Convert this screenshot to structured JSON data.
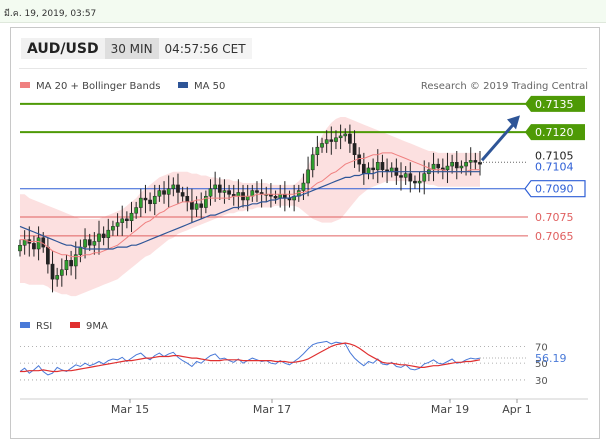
{
  "timestamp": "มี.ค. 19, 2019, 03:57",
  "header": {
    "symbol": "AUD/USD",
    "timeframe": "30 MIN",
    "clock": "04:57:56 CET"
  },
  "legend": {
    "ma20": {
      "label": "MA 20 + Bollinger Bands",
      "color": "#f08080"
    },
    "ma50": {
      "label": "MA 50",
      "color": "#2e5597"
    },
    "research": "Research © 2019 Trading Central",
    "rsi": {
      "label": "RSI",
      "color": "#4a7ad8"
    },
    "ma9": {
      "label": "9MA",
      "color": "#e03030"
    }
  },
  "chart_data": [
    {
      "type": "candlestick",
      "x_ticks": [
        "Mar 15",
        "Mar 17",
        "Mar 19",
        "Apr 1"
      ],
      "ylim": [
        0.7023,
        0.7145
      ],
      "grid": false,
      "levels": [
        {
          "value": 0.7135,
          "label": "0.7135",
          "kind": "resistance",
          "color": "#4e9a06"
        },
        {
          "value": 0.712,
          "label": "0.7120",
          "kind": "resistance",
          "color": "#4e9a06"
        },
        {
          "value": 0.709,
          "label": "0.7090",
          "kind": "pivot",
          "color": "#2e5fd6"
        },
        {
          "value": 0.7075,
          "label": "0.7075",
          "kind": "support",
          "color": "#e06060"
        },
        {
          "value": 0.7065,
          "label": "0.7065",
          "kind": "support",
          "color": "#e06060"
        }
      ],
      "current_price": {
        "value": 0.7104,
        "label": "0.7104"
      },
      "hidden_price_label": "0.7105",
      "close_series": [
        0.706,
        0.7063,
        0.7061,
        0.7058,
        0.7064,
        0.7059,
        0.705,
        0.7042,
        0.7044,
        0.7047,
        0.7052,
        0.7049,
        0.7055,
        0.7059,
        0.7063,
        0.706,
        0.7062,
        0.7066,
        0.7064,
        0.7068,
        0.707,
        0.7072,
        0.7074,
        0.7073,
        0.7077,
        0.708,
        0.7085,
        0.7084,
        0.7082,
        0.7086,
        0.7089,
        0.7087,
        0.709,
        0.7092,
        0.7088,
        0.7086,
        0.7083,
        0.7079,
        0.7082,
        0.708,
        0.7086,
        0.709,
        0.7092,
        0.7088,
        0.7089,
        0.7087,
        0.7086,
        0.7088,
        0.7084,
        0.7086,
        0.7089,
        0.7088,
        0.7087,
        0.7087,
        0.7086,
        0.7085,
        0.7087,
        0.7085,
        0.7084,
        0.7086,
        0.7089,
        0.7093,
        0.71,
        0.7108,
        0.7112,
        0.7114,
        0.7116,
        0.7115,
        0.7117,
        0.7118,
        0.7119,
        0.7114,
        0.7108,
        0.7103,
        0.7098,
        0.7101,
        0.71,
        0.7104,
        0.71,
        0.7099,
        0.7101,
        0.7097,
        0.7096,
        0.7098,
        0.7094,
        0.7093,
        0.7094,
        0.7098,
        0.71,
        0.7103,
        0.7101,
        0.71,
        0.7102,
        0.7104,
        0.7101,
        0.7102,
        0.7104,
        0.7105,
        0.7104,
        0.7103
      ],
      "series": [
        {
          "name": "MA 20 + Bollinger Bands",
          "ma20": [
            0.7063,
            0.7063,
            0.7062,
            0.7062,
            0.7062,
            0.7061,
            0.7059,
            0.7057,
            0.7056,
            0.7055,
            0.7055,
            0.7054,
            0.7054,
            0.7054,
            0.7055,
            0.7055,
            0.7056,
            0.7056,
            0.7057,
            0.7058,
            0.7059,
            0.706,
            0.7062,
            0.7064,
            0.7066,
            0.7068,
            0.707,
            0.7072,
            0.7073,
            0.7075,
            0.7077,
            0.7078,
            0.708,
            0.7081,
            0.7082,
            0.7083,
            0.7083,
            0.7083,
            0.7084,
            0.7084,
            0.7085,
            0.7085,
            0.7085,
            0.7085,
            0.7085,
            0.7085,
            0.7086,
            0.7086,
            0.7086,
            0.7086,
            0.7086,
            0.7087,
            0.7087,
            0.7087,
            0.7087,
            0.7087,
            0.7087,
            0.7087,
            0.7087,
            0.7087,
            0.7088,
            0.7088,
            0.7089,
            0.7091,
            0.7093,
            0.7094,
            0.7096,
            0.7098,
            0.7099,
            0.7101,
            0.7103,
            0.7104,
            0.7105,
            0.7106,
            0.7106,
            0.7107,
            0.7108,
            0.7108,
            0.7109,
            0.7109,
            0.7109,
            0.7108,
            0.7107,
            0.7106,
            0.7105,
            0.7104,
            0.7103,
            0.7102,
            0.7101,
            0.71,
            0.71,
            0.71,
            0.7099,
            0.7099,
            0.7099,
            0.7099,
            0.7099,
            0.71,
            0.71,
            0.71
          ],
          "upper": [
            0.7087,
            0.7087,
            0.7085,
            0.7084,
            0.7083,
            0.7082,
            0.7081,
            0.708,
            0.7079,
            0.7078,
            0.7077,
            0.7076,
            0.7075,
            0.7074,
            0.7074,
            0.7074,
            0.7074,
            0.7074,
            0.7075,
            0.7076,
            0.7077,
            0.7078,
            0.7079,
            0.7081,
            0.7083,
            0.7085,
            0.7088,
            0.709,
            0.7092,
            0.7094,
            0.7096,
            0.7097,
            0.7098,
            0.7099,
            0.7099,
            0.7099,
            0.7099,
            0.7098,
            0.7098,
            0.7097,
            0.7097,
            0.7096,
            0.7096,
            0.7095,
            0.7095,
            0.7095,
            0.7094,
            0.7094,
            0.7093,
            0.7093,
            0.7093,
            0.7093,
            0.7093,
            0.7093,
            0.7092,
            0.7092,
            0.7092,
            0.7092,
            0.7092,
            0.7092,
            0.7094,
            0.7097,
            0.7102,
            0.7108,
            0.7113,
            0.7118,
            0.7122,
            0.7125,
            0.7127,
            0.7128,
            0.7128,
            0.7127,
            0.7126,
            0.7125,
            0.7124,
            0.7123,
            0.7122,
            0.7121,
            0.712,
            0.7119,
            0.7118,
            0.7117,
            0.7116,
            0.7115,
            0.7114,
            0.7113,
            0.7112,
            0.7111,
            0.711,
            0.711,
            0.7109,
            0.7109,
            0.7109,
            0.7109,
            0.7109,
            0.7109,
            0.7109,
            0.7109,
            0.7109,
            0.7109
          ],
          "lower": [
            0.704,
            0.704,
            0.7039,
            0.7039,
            0.7039,
            0.7039,
            0.7038,
            0.7036,
            0.7035,
            0.7034,
            0.7034,
            0.7033,
            0.7033,
            0.7034,
            0.7035,
            0.7036,
            0.7037,
            0.7038,
            0.7039,
            0.704,
            0.7041,
            0.7042,
            0.7044,
            0.7046,
            0.7048,
            0.705,
            0.7052,
            0.7054,
            0.7055,
            0.7057,
            0.7059,
            0.7061,
            0.7063,
            0.7064,
            0.7066,
            0.7067,
            0.7068,
            0.7069,
            0.707,
            0.7071,
            0.7072,
            0.7073,
            0.7074,
            0.7075,
            0.7076,
            0.7077,
            0.7077,
            0.7078,
            0.7078,
            0.7079,
            0.7079,
            0.708,
            0.708,
            0.708,
            0.708,
            0.7081,
            0.7081,
            0.7081,
            0.7081,
            0.7081,
            0.708,
            0.7078,
            0.7076,
            0.7074,
            0.7073,
            0.7072,
            0.7072,
            0.7072,
            0.7073,
            0.7074,
            0.7077,
            0.708,
            0.7083,
            0.7086,
            0.7088,
            0.709,
            0.7091,
            0.7092,
            0.7093,
            0.7094,
            0.7094,
            0.7094,
            0.7094,
            0.7094,
            0.7094,
            0.7094,
            0.7093,
            0.7093,
            0.7092,
            0.7092,
            0.7091,
            0.7091,
            0.7091,
            0.7091,
            0.7091,
            0.7091,
            0.7091,
            0.7091,
            0.7091,
            0.7091
          ]
        },
        {
          "name": "MA 50",
          "values": [
            0.707,
            0.7069,
            0.7068,
            0.7067,
            0.7066,
            0.7065,
            0.7064,
            0.7063,
            0.7062,
            0.7061,
            0.706,
            0.706,
            0.7059,
            0.7059,
            0.7058,
            0.7058,
            0.7058,
            0.7058,
            0.7058,
            0.7058,
            0.7058,
            0.7059,
            0.7059,
            0.7059,
            0.706,
            0.706,
            0.7061,
            0.7062,
            0.7063,
            0.7064,
            0.7065,
            0.7066,
            0.7067,
            0.7068,
            0.7069,
            0.707,
            0.7071,
            0.7072,
            0.7073,
            0.7074,
            0.7075,
            0.7076,
            0.7076,
            0.7077,
            0.7078,
            0.7079,
            0.708,
            0.708,
            0.7081,
            0.7081,
            0.7082,
            0.7082,
            0.7083,
            0.7083,
            0.7084,
            0.7084,
            0.7085,
            0.7085,
            0.7085,
            0.7086,
            0.7086,
            0.7087,
            0.7088,
            0.7089,
            0.709,
            0.7091,
            0.7092,
            0.7093,
            0.7094,
            0.7095,
            0.7096,
            0.7096,
            0.7097,
            0.7097,
            0.7098,
            0.7098,
            0.7098,
            0.7099,
            0.7099,
            0.7099,
            0.7099,
            0.7099,
            0.7099,
            0.7099,
            0.7099,
            0.7099,
            0.7099,
            0.7099,
            0.7099,
            0.7099,
            0.7099,
            0.7099,
            0.7099,
            0.7099,
            0.7099,
            0.7099,
            0.7099,
            0.7099,
            0.7099,
            0.7099
          ]
        }
      ],
      "forecast": {
        "from": 0.7104,
        "to": 0.7131
      }
    },
    {
      "type": "line",
      "name": "RSI",
      "ylim": [
        18,
        80
      ],
      "y_ticks": [
        30,
        50,
        70
      ],
      "current": {
        "value": 56.19,
        "label": "56.19"
      },
      "series": [
        {
          "name": "RSI",
          "values": [
            40,
            44,
            38,
            42,
            47,
            40,
            36,
            38,
            45,
            42,
            40,
            44,
            48,
            46,
            50,
            47,
            49,
            52,
            49,
            53,
            55,
            54,
            57,
            52,
            56,
            60,
            62,
            57,
            54,
            59,
            62,
            58,
            61,
            63,
            57,
            53,
            50,
            46,
            52,
            50,
            55,
            59,
            61,
            55,
            56,
            53,
            51,
            55,
            50,
            53,
            56,
            54,
            52,
            53,
            50,
            49,
            53,
            50,
            48,
            52,
            56,
            61,
            67,
            72,
            74,
            75,
            76,
            73,
            75,
            74,
            73,
            63,
            56,
            51,
            47,
            52,
            50,
            55,
            49,
            48,
            51,
            46,
            45,
            48,
            43,
            42,
            44,
            49,
            51,
            54,
            50,
            49,
            52,
            55,
            50,
            51,
            54,
            56,
            55,
            56
          ]
        },
        {
          "name": "9MA",
          "values": [
            40,
            40,
            41,
            41,
            41,
            42,
            41,
            40,
            40,
            41,
            41,
            41,
            42,
            43,
            44,
            45,
            46,
            47,
            48,
            49,
            50,
            51,
            52,
            53,
            53,
            54,
            55,
            56,
            56,
            57,
            58,
            58,
            58,
            59,
            59,
            58,
            57,
            56,
            56,
            55,
            54,
            53,
            53,
            53,
            54,
            54,
            54,
            54,
            53,
            53,
            53,
            53,
            53,
            53,
            53,
            52,
            52,
            52,
            51,
            51,
            52,
            53,
            55,
            58,
            61,
            64,
            67,
            70,
            72,
            73,
            74,
            73,
            71,
            68,
            64,
            60,
            57,
            54,
            51,
            50,
            50,
            49,
            48,
            48,
            47,
            46,
            45,
            45,
            46,
            47,
            47,
            48,
            49,
            50,
            51,
            51,
            52,
            52,
            53,
            54
          ]
        }
      ]
    }
  ]
}
